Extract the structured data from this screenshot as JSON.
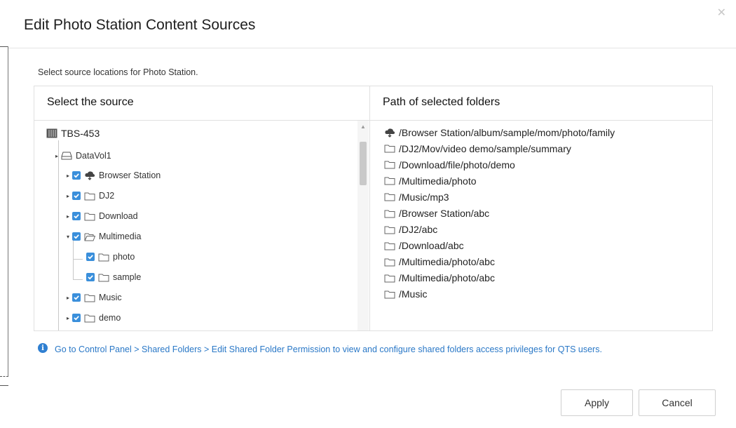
{
  "dialog": {
    "title": "Edit Photo Station Content Sources",
    "instruction": "Select source locations for Photo Station."
  },
  "left_pane": {
    "header": "Select the source",
    "tree": {
      "root": "TBS-453",
      "volume": "DataVol1",
      "folders": [
        {
          "label": "Browser Station",
          "checked": true,
          "icon": "cloud-folder-icon"
        },
        {
          "label": "DJ2",
          "checked": true,
          "icon": "folder-icon"
        },
        {
          "label": "Download",
          "checked": true,
          "icon": "folder-icon"
        },
        {
          "label": "Multimedia",
          "checked": true,
          "icon": "folder-open-icon",
          "expanded": true,
          "children": [
            {
              "label": "photo",
              "checked": true,
              "icon": "folder-icon"
            },
            {
              "label": "sample",
              "checked": true,
              "icon": "folder-icon"
            }
          ]
        },
        {
          "label": "Music",
          "checked": true,
          "icon": "folder-icon"
        },
        {
          "label": "demo",
          "checked": true,
          "icon": "folder-icon"
        }
      ]
    }
  },
  "right_pane": {
    "header": "Path of selected folders",
    "paths": [
      {
        "path": "/Browser Station/album/sample/mom/photo/family",
        "icon": "cloud-folder-icon"
      },
      {
        "path": "/DJ2/Mov/video demo/sample/summary",
        "icon": "folder-icon"
      },
      {
        "path": "/Download/file/photo/demo",
        "icon": "folder-icon"
      },
      {
        "path": "/Multimedia/photo",
        "icon": "folder-icon"
      },
      {
        "path": "/Music/mp3",
        "icon": "folder-icon"
      },
      {
        "path": "/Browser Station/abc",
        "icon": "folder-icon"
      },
      {
        "path": "/DJ2/abc",
        "icon": "folder-icon"
      },
      {
        "path": "/Download/abc",
        "icon": "folder-icon"
      },
      {
        "path": "/Multimedia/photo/abc",
        "icon": "folder-icon"
      },
      {
        "path": "/Multimedia/photo/abc",
        "icon": "folder-icon"
      },
      {
        "path": "/Music",
        "icon": "folder-icon"
      }
    ]
  },
  "info": {
    "text": "Go to Control Panel > Shared Folders > Edit Shared Folder Permission to view and configure shared folders access privileges for QTS users."
  },
  "buttons": {
    "apply": "Apply",
    "cancel": "Cancel"
  },
  "colors": {
    "accent": "#3a8fdb",
    "info_text": "#2a78c7",
    "border": "#e0e0e0"
  }
}
